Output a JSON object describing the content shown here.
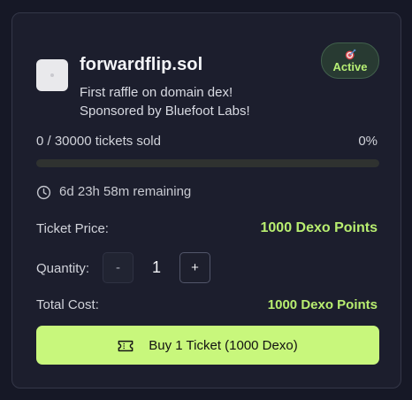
{
  "raffle": {
    "title": "forwardflip.sol",
    "description_line1": "First raffle on domain dex!",
    "description_line2": "Sponsored by Bluefoot Labs!",
    "status": "Active"
  },
  "progress": {
    "sold_text": "0 / 30000 tickets sold",
    "percent_text": "0%",
    "fraction": 0
  },
  "timer": {
    "remaining_text": "6d 23h 58m remaining"
  },
  "purchase": {
    "price_label": "Ticket Price:",
    "price_value": "1000 Dexo Points",
    "quantity_label": "Quantity:",
    "minus_label": "-",
    "quantity_value": "1",
    "plus_label": "+",
    "total_label": "Total Cost:",
    "total_value": "1000 Dexo Points",
    "buy_label": "Buy 1 Ticket (1000 Dexo)"
  },
  "icons": {
    "status": "target-icon",
    "timer": "clock-icon",
    "buy": "ticket-icon"
  },
  "colors": {
    "accent": "#c8f77c",
    "accent_text": "#b8ee70",
    "card_bg": "#1c1e2d",
    "page_bg": "#161826"
  }
}
